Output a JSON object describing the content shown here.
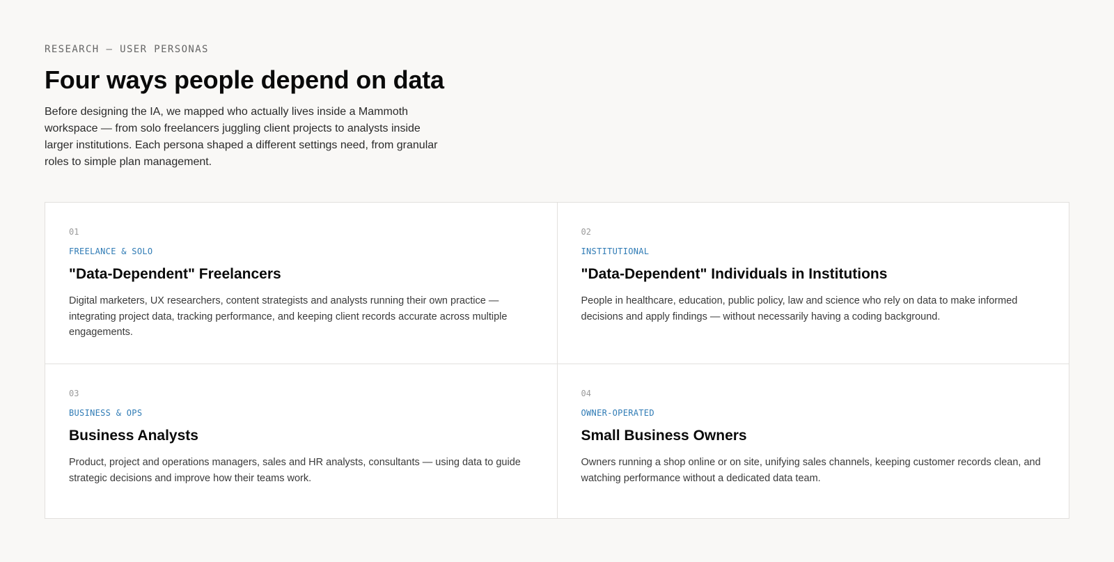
{
  "header": {
    "eyebrow": "RESEARCH — USER PERSONAS",
    "title": "Four ways people depend on data",
    "intro": "Before designing the IA, we mapped who actually lives inside a Mammoth workspace — from solo freelancers juggling client projects to analysts inside larger institutions. Each persona shaped a different settings need, from granular roles to simple plan management."
  },
  "colors": {
    "background": "#f9f8f6",
    "card": "#ffffff",
    "accent": "#2f7bb5",
    "border": "#e2e0dd"
  },
  "personas": [
    {
      "number": "01",
      "tag": "FREELANCE & SOLO",
      "title": "\"Data-Dependent\" Freelancers",
      "body": "Digital marketers, UX researchers, content strategists and analysts running their own practice — integrating project data, tracking performance, and keeping client records accurate across multiple engagements."
    },
    {
      "number": "02",
      "tag": "INSTITUTIONAL",
      "title": "\"Data-Dependent\" Individuals in Institutions",
      "body": "People in healthcare, education, public policy, law and science who rely on data to make informed decisions and apply findings — without necessarily having a coding background."
    },
    {
      "number": "03",
      "tag": "BUSINESS & OPS",
      "title": "Business Analysts",
      "body": "Product, project and operations managers, sales and HR analysts, consultants — using data to guide strategic decisions and improve how their teams work."
    },
    {
      "number": "04",
      "tag": "OWNER-OPERATED",
      "title": "Small Business Owners",
      "body": "Owners running a shop online or on site, unifying sales channels, keeping customer records clean, and watching performance without a dedicated data team."
    }
  ]
}
